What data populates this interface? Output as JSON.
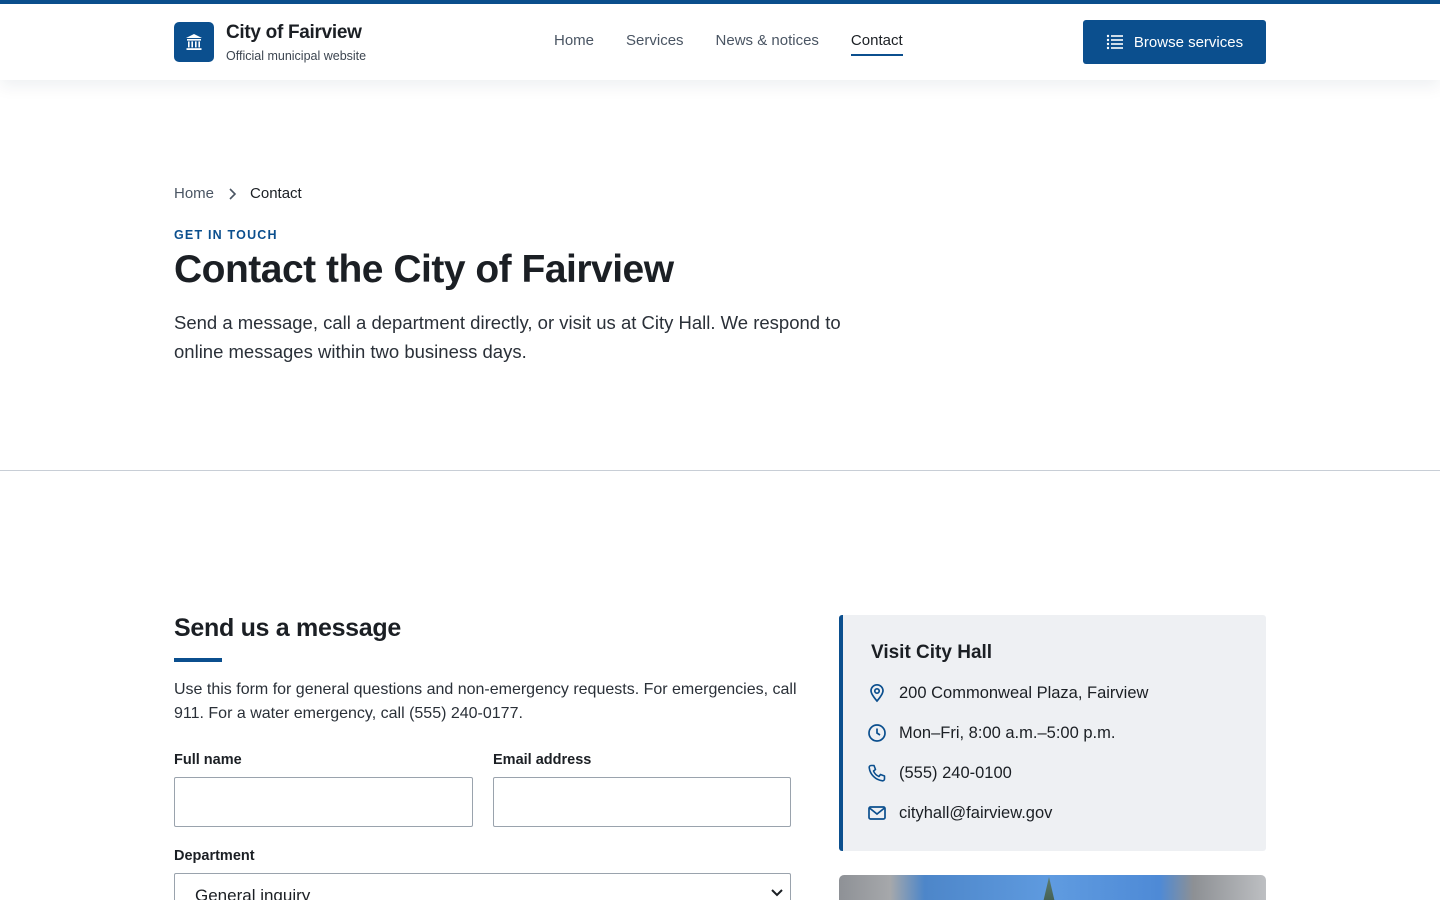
{
  "header": {
    "brand_name": "City of Fairview",
    "brand_sub": "Official municipal website",
    "logo_icon": "building-columns-icon",
    "nav": [
      {
        "label": "Home",
        "active": false
      },
      {
        "label": "Services",
        "active": false
      },
      {
        "label": "News & notices",
        "active": false
      },
      {
        "label": "Contact",
        "active": true
      }
    ],
    "cta_label": "Browse services",
    "cta_icon": "list-icon"
  },
  "breadcrumb": {
    "home": "Home",
    "current": "Contact"
  },
  "hero": {
    "eyebrow": "GET IN TOUCH",
    "title": "Contact the City of Fairview",
    "lede": "Send a message, call a department directly, or visit us at City Hall. We respond to online messages within two business days."
  },
  "form": {
    "title": "Send us a message",
    "intro": "Use this form for general questions and non-emergency requests. For emergencies, call 911. For a water emergency, call (555) 240-0177.",
    "full_name_label": "Full name",
    "full_name_value": "",
    "email_label": "Email address",
    "email_value": "",
    "department_label": "Department",
    "department_value": "General inquiry"
  },
  "visit": {
    "title": "Visit City Hall",
    "address": "200 Commonweal Plaza, Fairview",
    "hours": "Mon–Fri, 8:00 a.m.–5:00 p.m.",
    "phone": "(555) 240-0100",
    "email": "cityhall@fairview.gov"
  },
  "colors": {
    "primary": "#0b4f8e",
    "text": "#1b1f24",
    "card_bg": "#eef0f3"
  }
}
